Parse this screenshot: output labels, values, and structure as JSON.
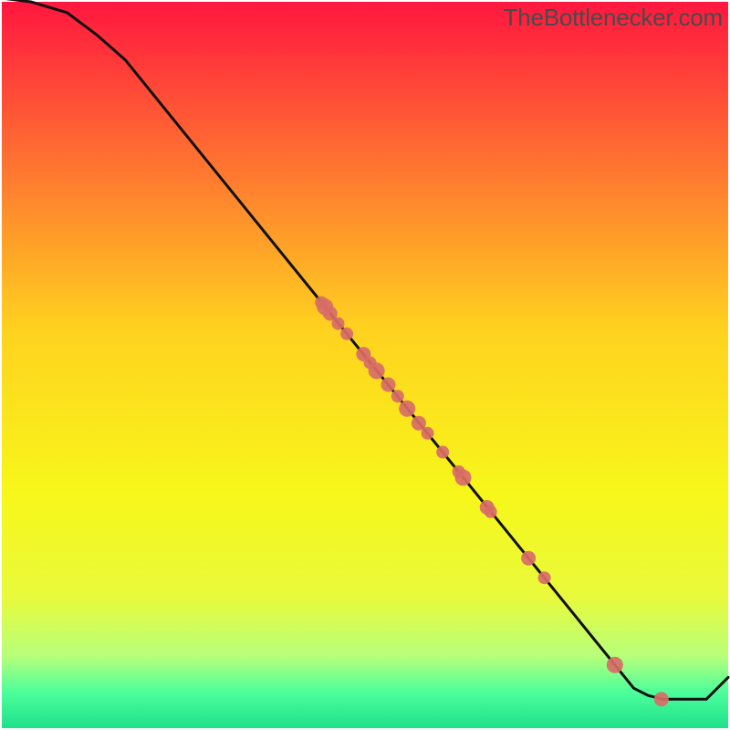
{
  "attribution": "TheBottlenecker.com",
  "chart_data": {
    "type": "line",
    "title": "",
    "xlabel": "",
    "ylabel": "",
    "xlim": [
      0,
      100
    ],
    "ylim": [
      0,
      100
    ],
    "gradient_stops": [
      {
        "offset": 0,
        "color": "#ff173f"
      },
      {
        "offset": 0.25,
        "color": "#ff7e2f"
      },
      {
        "offset": 0.45,
        "color": "#ffd21f"
      },
      {
        "offset": 0.68,
        "color": "#f7f71a"
      },
      {
        "offset": 0.82,
        "color": "#e8fa3c"
      },
      {
        "offset": 0.9,
        "color": "#b8ff7a"
      },
      {
        "offset": 0.95,
        "color": "#4dff9a"
      },
      {
        "offset": 1.0,
        "color": "#1fe08c"
      }
    ],
    "curve": [
      {
        "x": 0,
        "y": 100.5
      },
      {
        "x": 4,
        "y": 100
      },
      {
        "x": 9,
        "y": 98.5
      },
      {
        "x": 13,
        "y": 95.5
      },
      {
        "x": 17,
        "y": 92
      },
      {
        "x": 87,
        "y": 5.5
      },
      {
        "x": 89,
        "y": 4.5
      },
      {
        "x": 91,
        "y": 4
      },
      {
        "x": 97,
        "y": 4
      },
      {
        "x": 100,
        "y": 7
      }
    ],
    "points": [
      {
        "x": 44.0,
        "y": 58.6,
        "r": 7
      },
      {
        "x": 44.5,
        "y": 58.0,
        "r": 9
      },
      {
        "x": 45.2,
        "y": 57.1,
        "r": 8
      },
      {
        "x": 46.3,
        "y": 55.7,
        "r": 7
      },
      {
        "x": 47.5,
        "y": 54.3,
        "r": 7
      },
      {
        "x": 49.8,
        "y": 51.5,
        "r": 8
      },
      {
        "x": 50.7,
        "y": 50.3,
        "r": 7
      },
      {
        "x": 51.6,
        "y": 49.2,
        "r": 9
      },
      {
        "x": 53.2,
        "y": 47.3,
        "r": 8
      },
      {
        "x": 54.5,
        "y": 45.7,
        "r": 7
      },
      {
        "x": 55.8,
        "y": 44.0,
        "r": 9
      },
      {
        "x": 57.4,
        "y": 42.0,
        "r": 8
      },
      {
        "x": 58.6,
        "y": 40.6,
        "r": 7
      },
      {
        "x": 60.7,
        "y": 38.0,
        "r": 7
      },
      {
        "x": 62.9,
        "y": 35.3,
        "r": 7
      },
      {
        "x": 63.5,
        "y": 34.5,
        "r": 9
      },
      {
        "x": 66.8,
        "y": 30.4,
        "r": 8
      },
      {
        "x": 67.3,
        "y": 29.8,
        "r": 7
      },
      {
        "x": 72.5,
        "y": 23.4,
        "r": 8
      },
      {
        "x": 74.7,
        "y": 20.7,
        "r": 7
      },
      {
        "x": 84.4,
        "y": 8.7,
        "r": 9
      },
      {
        "x": 90.8,
        "y": 4.0,
        "r": 8
      }
    ],
    "point_color": "#d86c67"
  }
}
